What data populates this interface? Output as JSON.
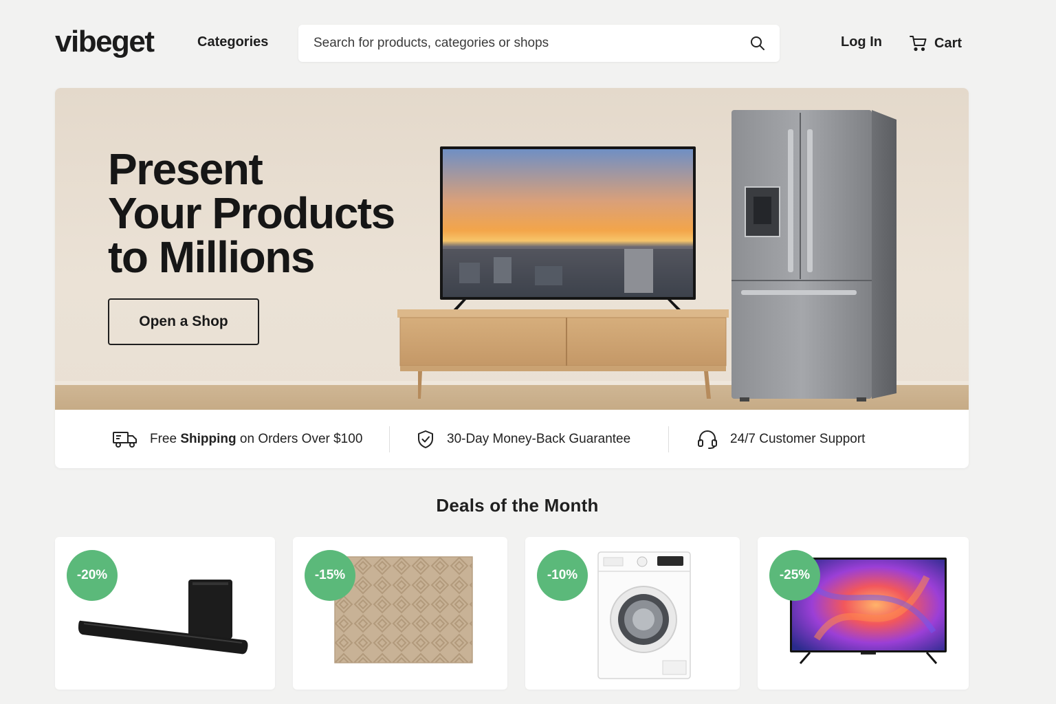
{
  "header": {
    "logo": "vibeget",
    "categories_label": "Categories",
    "search_placeholder": "Search for products, categories or shops",
    "login_label": "Log In",
    "cart_label": "Cart"
  },
  "hero": {
    "title_lines": [
      "Present",
      "Your Products",
      "to Millions"
    ],
    "cta_label": "Open a Shop"
  },
  "perks": {
    "shipping_prefix": "Free",
    "shipping_bold": "Shipping",
    "shipping_suffix": "on Orders Over $100",
    "guarantee": "30-Day Money-Back Guarantee",
    "support": "24/7 Customer Support"
  },
  "deals": {
    "title": "Deals of the Month",
    "items": [
      {
        "discount": "-20%",
        "icon": "soundbar-icon"
      },
      {
        "discount": "-15%",
        "icon": "rug-icon"
      },
      {
        "discount": "-10%",
        "icon": "washing-machine-icon"
      },
      {
        "discount": "-25%",
        "icon": "tv-icon"
      }
    ]
  },
  "colors": {
    "accent_green": "#5bb97a",
    "background": "#f2f2f1",
    "hero_wall": "#e4d9cb"
  }
}
